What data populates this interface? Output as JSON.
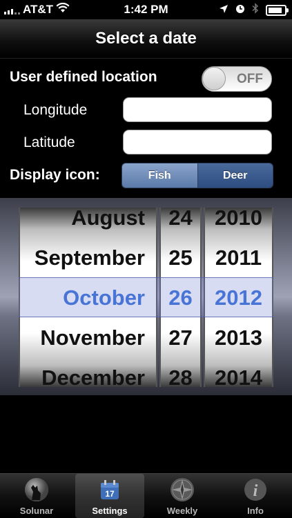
{
  "status": {
    "carrier": "AT&T",
    "time": "1:42 PM",
    "battery_level": 0.85
  },
  "nav": {
    "title": "Select a date"
  },
  "settings": {
    "user_location_label": "User defined location",
    "toggle_state": "OFF",
    "longitude_label": "Longitude",
    "longitude_value": "",
    "latitude_label": "Latitude",
    "latitude_value": "",
    "display_icon_label": "Display icon:",
    "segments": [
      "Fish",
      "Deer"
    ],
    "selected_segment": "Deer"
  },
  "picker": {
    "months": [
      "August",
      "September",
      "October",
      "November",
      "December"
    ],
    "days": [
      "24",
      "25",
      "26",
      "27",
      "28"
    ],
    "years": [
      "2010",
      "2011",
      "2012",
      "2013",
      "2014"
    ],
    "selected": {
      "month": "October",
      "day": "26",
      "year": "2012"
    }
  },
  "tabs": [
    {
      "label": "Solunar",
      "icon": "wolf-moon-icon"
    },
    {
      "label": "Settings",
      "icon": "calendar-icon"
    },
    {
      "label": "Weekly",
      "icon": "compass-icon"
    },
    {
      "label": "Info",
      "icon": "info-icon"
    }
  ],
  "active_tab": "Settings",
  "colors": {
    "selected_text": "#3a6fd9",
    "segment_selected": "#2d4d80"
  }
}
